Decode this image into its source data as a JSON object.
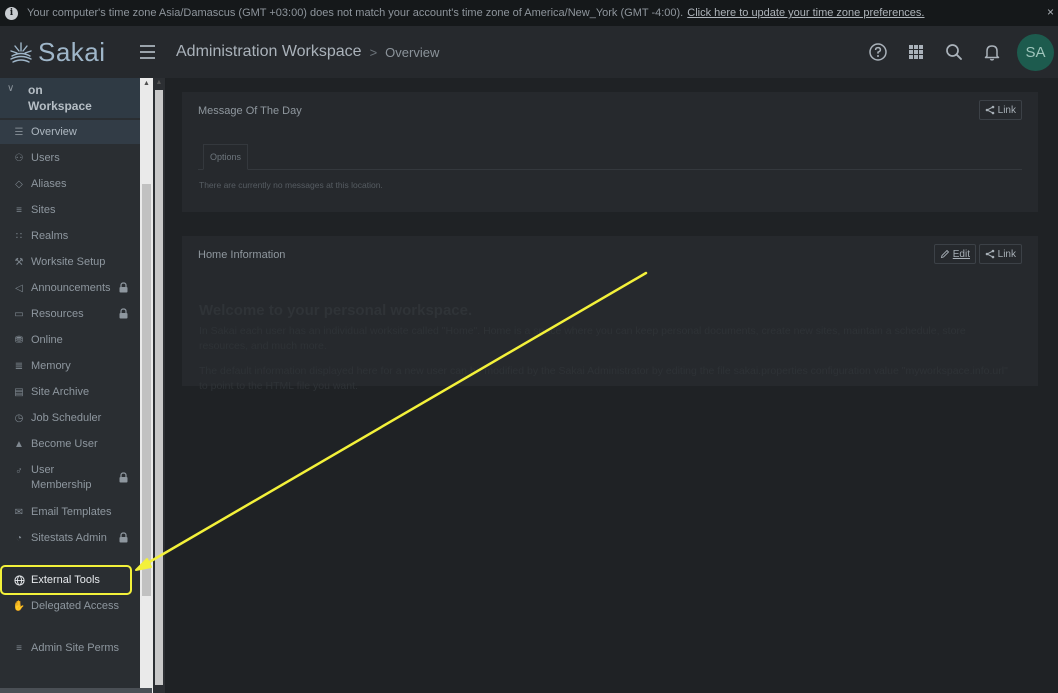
{
  "banner": {
    "message": "Your computer's time zone Asia/Damascus (GMT +03:00) does not match your account's time zone of America/New_York (GMT -4:00).",
    "link_text": "Click here to update your time zone preferences.",
    "close": "×"
  },
  "header": {
    "logo_text": "Sakai",
    "site_title": "Administration Workspace",
    "separator": ">",
    "page_title": "Overview",
    "avatar_initials": "SA",
    "icons": [
      "help-icon",
      "apps-grid-icon",
      "search-icon",
      "bell-icon"
    ]
  },
  "sidebar": {
    "site_title_line1": "on",
    "site_title_line2": "Workspace",
    "items": [
      {
        "label": "Overview",
        "icon": "list-icon",
        "active": true
      },
      {
        "label": "Users",
        "icon": "users-icon"
      },
      {
        "label": "Aliases",
        "icon": "tag-icon"
      },
      {
        "label": "Sites",
        "icon": "sites-icon"
      },
      {
        "label": "Realms",
        "icon": "realms-icon"
      },
      {
        "label": "Worksite Setup",
        "icon": "wrench-icon"
      },
      {
        "label": "Announcements",
        "icon": "megaphone-icon",
        "locked": true
      },
      {
        "label": "Resources",
        "icon": "folder-icon",
        "locked": true
      },
      {
        "label": "Online",
        "icon": "database-icon"
      },
      {
        "label": "Memory",
        "icon": "memory-icon"
      },
      {
        "label": "Site Archive",
        "icon": "archive-icon"
      },
      {
        "label": "Job Scheduler",
        "icon": "clock-icon"
      },
      {
        "label": "Become User",
        "icon": "incognito-icon"
      },
      {
        "label": "User Membership",
        "line1": "User",
        "line2": "Membership",
        "icon": "user-icon",
        "locked": true
      },
      {
        "label": "Email Templates",
        "icon": "envelope-icon"
      },
      {
        "label": "Sitestats Admin",
        "icon": "stats-icon",
        "locked": true
      },
      {
        "label": "External Tools",
        "icon": "globe-icon",
        "highlighted": true
      },
      {
        "label": "Delegated Access",
        "icon": "hand-icon"
      },
      {
        "label": "Admin Site Perms",
        "icon": "sliders-icon"
      }
    ]
  },
  "main": {
    "motd": {
      "title": "Message Of The Day",
      "link_label": "Link",
      "tab_options": "Options",
      "empty_message": "There are currently no messages at this location."
    },
    "home": {
      "title": "Home Information",
      "edit_label": "Edit",
      "link_label": "Link",
      "welcome_heading": "Welcome to your personal workspace.",
      "paragraph1": "In Sakai each user has an individual worksite called \"Home\". Home is a space where you can keep personal documents, create new sites, maintain a schedule, store resources, and much more.",
      "paragraph2": "The default information displayed here for a new user can be modified by the Sakai Administrator by editing the file sakai.properties configuration value \"myworkspace.info.url\" to point to the HTML file you want."
    }
  },
  "annotation": {
    "color": "#f3f13a"
  }
}
